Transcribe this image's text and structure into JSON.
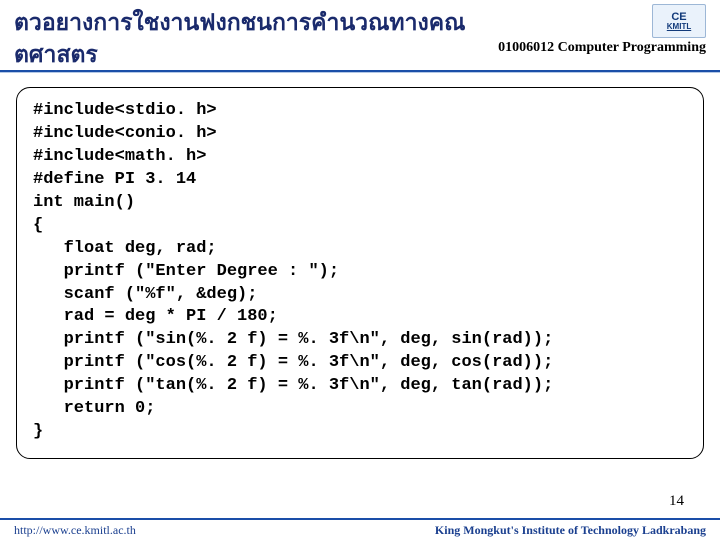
{
  "header": {
    "title_line1": "ตวอยางการใชงานฟงกชนการคำนวณทางคณ",
    "title_line2": "ตศาสตร",
    "course": "01006012 Computer Programming",
    "logo_top": "CE",
    "logo_bottom": "KMITL"
  },
  "code": "#include<stdio. h>\n#include<conio. h>\n#include<math. h>\n#define PI 3. 14\nint main()\n{\n   float deg, rad;\n   printf (\"Enter Degree : \");\n   scanf (\"%f\", &deg);\n   rad = deg * PI / 180;\n   printf (\"sin(%. 2 f) = %. 3f\\n\", deg, sin(rad));\n   printf (\"cos(%. 2 f) = %. 3f\\n\", deg, cos(rad));\n   printf (\"tan(%. 2 f) = %. 3f\\n\", deg, tan(rad));\n   return 0;\n}",
  "page_number": "14",
  "footer": {
    "left": "http://www.ce.kmitl.ac.th",
    "right": "King Mongkut's Institute of Technology Ladkrabang"
  }
}
